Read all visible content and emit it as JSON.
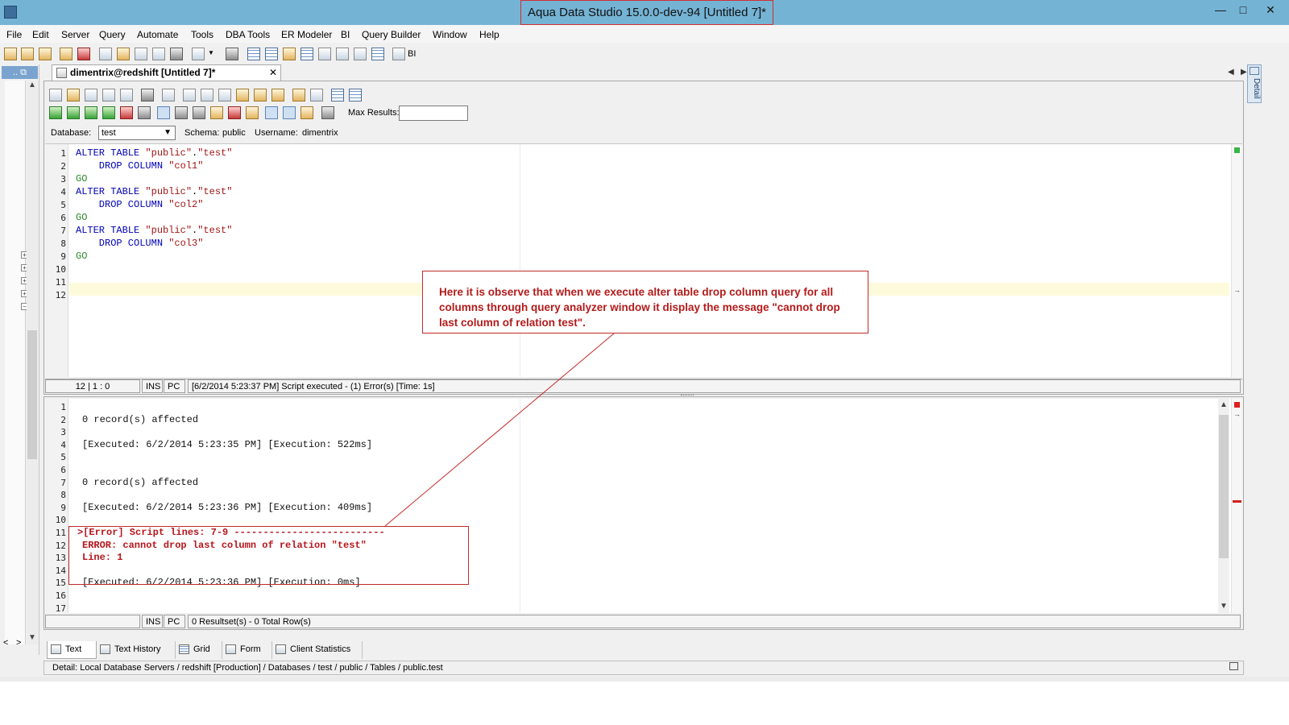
{
  "window": {
    "title": "Aqua Data Studio 15.0.0-dev-94 [Untitled 7]*",
    "controls": {
      "minimize": "—",
      "maximize": "□",
      "close": "✕"
    }
  },
  "menu": [
    "File",
    "Edit",
    "Server",
    "Query",
    "Automate",
    "Tools",
    "DBA Tools",
    "ER Modeler",
    "BI",
    "Query Builder",
    "Window",
    "Help"
  ],
  "main_toolbar": {
    "bi_label": "BI"
  },
  "navigator": {
    "header": ".. ⧉"
  },
  "document_tab": {
    "label": "dimentrix@redshift [Untitled 7]*",
    "close": "✕"
  },
  "tab_nav": {
    "prev": "◀",
    "next": "▶",
    "list": "▤"
  },
  "side_panel": {
    "label": "Detail"
  },
  "query_toolbar": {
    "max_results_label": "Max Results:",
    "max_results_value": ""
  },
  "connection": {
    "database_label": "Database:",
    "database_value": "test",
    "schema_label": "Schema:",
    "schema_value": "public",
    "username_label": "Username:",
    "username_value": "dimentrix"
  },
  "editor": {
    "line_numbers": [
      "1",
      "2",
      "3",
      "4",
      "5",
      "6",
      "7",
      "8",
      "9",
      "10",
      "11",
      "12"
    ],
    "lines": [
      [
        {
          "t": "ALTER TABLE ",
          "c": "kw"
        },
        {
          "t": "\"public\"",
          "c": "str"
        },
        {
          "t": ".",
          "c": ""
        },
        {
          "t": "\"test\"",
          "c": "str"
        }
      ],
      [
        {
          "t": "    DROP COLUMN ",
          "c": "kw"
        },
        {
          "t": "\"col1\"",
          "c": "str"
        }
      ],
      [
        {
          "t": "GO",
          "c": "go"
        }
      ],
      [
        {
          "t": "ALTER TABLE ",
          "c": "kw"
        },
        {
          "t": "\"public\"",
          "c": "str"
        },
        {
          "t": ".",
          "c": ""
        },
        {
          "t": "\"test\"",
          "c": "str"
        }
      ],
      [
        {
          "t": "    DROP COLUMN ",
          "c": "kw"
        },
        {
          "t": "\"col2\"",
          "c": "str"
        }
      ],
      [
        {
          "t": "GO",
          "c": "go"
        }
      ],
      [
        {
          "t": "ALTER TABLE ",
          "c": "kw"
        },
        {
          "t": "\"public\"",
          "c": "str"
        },
        {
          "t": ".",
          "c": ""
        },
        {
          "t": "\"test\"",
          "c": "str"
        }
      ],
      [
        {
          "t": "    DROP COLUMN ",
          "c": "kw"
        },
        {
          "t": "\"col3\"",
          "c": "str"
        }
      ],
      [
        {
          "t": "GO",
          "c": "go"
        }
      ],
      [],
      [],
      []
    ]
  },
  "editor_status": {
    "position": "12 | 1 : 0",
    "mode": "INS",
    "encoding": "PC",
    "message": "[6/2/2014 5:23:37 PM] Script executed - (1) Error(s) [Time: 1s]"
  },
  "results": {
    "line_numbers": [
      "1",
      "2",
      "3",
      "4",
      "5",
      "6",
      "7",
      "8",
      "9",
      "10",
      "11",
      "12",
      "13",
      "14",
      "15",
      "16",
      "17"
    ],
    "lines": [
      {
        "t": "",
        "c": ""
      },
      {
        "t": "0 record(s) affected",
        "c": ""
      },
      {
        "t": "",
        "c": ""
      },
      {
        "t": "[Executed: 6/2/2014 5:23:35 PM] [Execution: 522ms]",
        "c": ""
      },
      {
        "t": "",
        "c": ""
      },
      {
        "t": "",
        "c": ""
      },
      {
        "t": "0 record(s) affected",
        "c": ""
      },
      {
        "t": "",
        "c": ""
      },
      {
        "t": "[Executed: 6/2/2014 5:23:36 PM] [Execution: 409ms]",
        "c": ""
      },
      {
        "t": "",
        "c": ""
      },
      {
        "t": ">[Error] Script lines: 7-9 --------------------------",
        "c": "err"
      },
      {
        "t": "ERROR: cannot drop last column of relation \"test\"",
        "c": "err"
      },
      {
        "t": "Line: 1",
        "c": "err"
      },
      {
        "t": "",
        "c": ""
      },
      {
        "t": "[Executed: 6/2/2014 5:23:36 PM] [Execution: 0ms]",
        "c": ""
      },
      {
        "t": "",
        "c": ""
      },
      {
        "t": "",
        "c": ""
      }
    ]
  },
  "results_status": {
    "mode": "INS",
    "encoding": "PC",
    "message": "0 Resultset(s) - 0 Total Row(s)"
  },
  "result_tabs": [
    "Text",
    "Text History",
    "Grid",
    "Form",
    "Client Statistics"
  ],
  "detail_bar": {
    "text": "Detail: Local Database Servers / redshift [Production] / Databases / test / public / Tables / public.test"
  },
  "annotation": {
    "callout": "Here it is observe that when we execute alter table drop column query for all columns through query analyzer window it display the message \"cannot drop last column of relation test\"."
  }
}
